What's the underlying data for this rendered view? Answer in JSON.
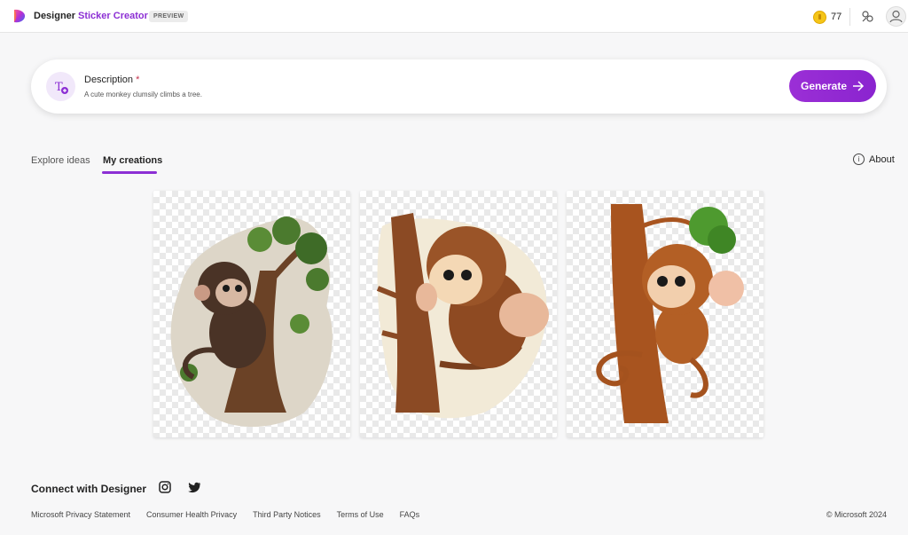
{
  "header": {
    "brand": "Designer",
    "app_name": "Sticker Creator",
    "badge": "PREVIEW",
    "coins": "77",
    "icons": [
      "designer-logo-icon",
      "coin-icon",
      "share-icon",
      "avatar-icon"
    ]
  },
  "prompt": {
    "label": "Description",
    "required_marker": "*",
    "value": "A cute monkey clumsily climbs a tree.",
    "generate_label": "Generate",
    "generate_color": "#8c2fd4"
  },
  "tabs": [
    {
      "label": "Explore ideas",
      "active": false
    },
    {
      "label": "My creations",
      "active": true
    }
  ],
  "about": {
    "label": "About",
    "icon": "info-icon"
  },
  "gallery": {
    "items": [
      {
        "subject": "monkey-sticker-1",
        "background": "transparent-checkerboard"
      },
      {
        "subject": "monkey-sticker-2",
        "background": "transparent-checkerboard"
      },
      {
        "subject": "monkey-sticker-3",
        "background": "transparent-checkerboard"
      }
    ]
  },
  "footer": {
    "connect": "Connect with Designer",
    "social_icons": [
      "instagram-icon",
      "twitter-icon"
    ],
    "links": [
      "Microsoft Privacy Statement",
      "Consumer Health Privacy",
      "Third Party Notices",
      "Terms of Use",
      "FAQs"
    ],
    "copyright": "© Microsoft 2024"
  }
}
